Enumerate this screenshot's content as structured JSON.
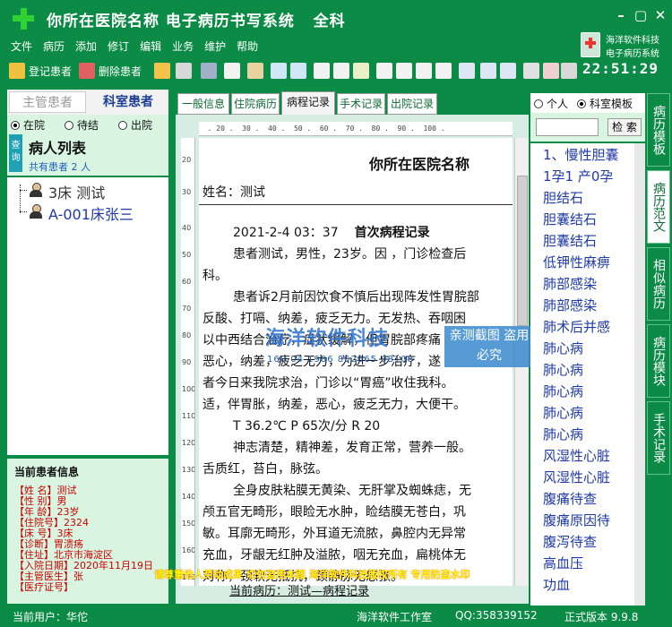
{
  "window": {
    "title": "你所在医院名称 电子病历书写系统   全科"
  },
  "menu": [
    "文件",
    "病历",
    "添加",
    "修订",
    "编辑",
    "业务",
    "维护",
    "帮助"
  ],
  "toolbar": {
    "register_label": "登记患者",
    "delete_label": "删除患者"
  },
  "brand": {
    "line1": "海洋软件科技",
    "line2": "电子病历系统",
    "clock": "22:51:29"
  },
  "left_panel": {
    "tab_owner": "主管患者",
    "tab_department": "科室患者",
    "radios": [
      "在院",
      "待结",
      "出院"
    ],
    "query_label": "查询",
    "list_title": "病人列表",
    "count_text": "共有患者 2 人",
    "patients": [
      "3床 测试",
      "A-001床张三"
    ]
  },
  "current_patient": {
    "title": "当前患者信息",
    "rows": [
      "【姓  名】测试",
      "【性  别】男",
      "【年  龄】23岁",
      "【住院号】2324",
      "【床  号】3床",
      "【诊断】胃溃疡",
      "【住址】北京市海淀区",
      "【入院日期】2020年11月19日",
      "【主管医生】张",
      "【医疗证号】"
    ]
  },
  "doc_tabs": [
    "一般信息",
    "住院病历",
    "病程记录",
    "手术记录",
    "出院记录"
  ],
  "document": {
    "ruler_h": "  . 20 .  30 .  40 .  50 .  60 .  70 .  80 .  90 .  100 .",
    "ruler_v": [
      "20",
      "30",
      "40",
      "50",
      "60",
      "70",
      "80",
      "90",
      "100",
      "110",
      "120",
      "130",
      "140",
      "150",
      "160",
      "170"
    ],
    "hospital": "你所在医院名称",
    "patient_name": "姓名：测试",
    "date": "2021-2-4 03：37",
    "record_title": "首次病程记录",
    "lines": [
      "患者测试，男性，23岁。因 ，门诊检查后",
      "科。",
      "患者诉2月前因饮食不慎后出现阵发性胃脘部",
      "反酸、打嗝、纳差，疲乏无力。无发热、吞咽困",
      "以中西结合治疗，症状缓解，但胃脘部疼痛",
      "恶心，纳差，疲乏无力，为进一步治疗，遂",
      "者今日来我院求治，门诊以“胃癌”收住我科。",
      "适，伴胃胀，纳差，恶心，疲乏无力，大便干。",
      "T 36.2℃      P 65次/分      R 20",
      "神志清楚，精神差，发育正常，营养一般。",
      "舌质红，苔白，脉弦。",
      "全身皮肤粘膜无黄染、无肝掌及蜘蛛痣，无",
      "颅五官无畸形，眼睑无水肿，睑结膜无苍白，巩",
      "敏。耳廓无畸形，外耳道无流脓，鼻腔内无异常",
      "充血，牙龈无红肿及溢脓，咽无充血，扁桃体无",
      "对称，颈软无抵抗，颈静脉无怒张。"
    ],
    "current_record": "当前病历：测试—病程记录"
  },
  "watermark": {
    "main": "海洋软件科技",
    "box": "亲测截图 盗用必究",
    "phone": "160 04 1986 852065 08108"
  },
  "warning": "请尊重他人劳动成果  切勿盗用本图  海洋软件科技版权所有  专用防盗水印",
  "right_panel": {
    "radios": [
      "个人",
      "科室模板"
    ],
    "search_label": "检 索",
    "items": [
      "1、慢性胆囊",
      "1孕1 产0孕",
      "胆结石",
      "胆囊结石",
      "胆囊结石",
      "低钾性麻痹",
      "肺部感染",
      "肺部感染",
      "肺术后并感",
      "肺心病",
      "肺心病",
      "肺心病",
      "肺心病",
      "肺心病",
      "风湿性心脏",
      "风湿性心脏",
      "腹痛待查",
      "腹痛原因待",
      "腹泻待查",
      "高血压",
      "功血"
    ]
  },
  "vtabs": [
    "病历模板",
    "病历范文",
    "相似病历",
    "病历模块",
    "手术记录"
  ],
  "status": {
    "user": "当前用户：华佗",
    "company": "海洋软件工作室",
    "qq": "QQ:358339152",
    "version": "正式版本 9.9.8"
  }
}
